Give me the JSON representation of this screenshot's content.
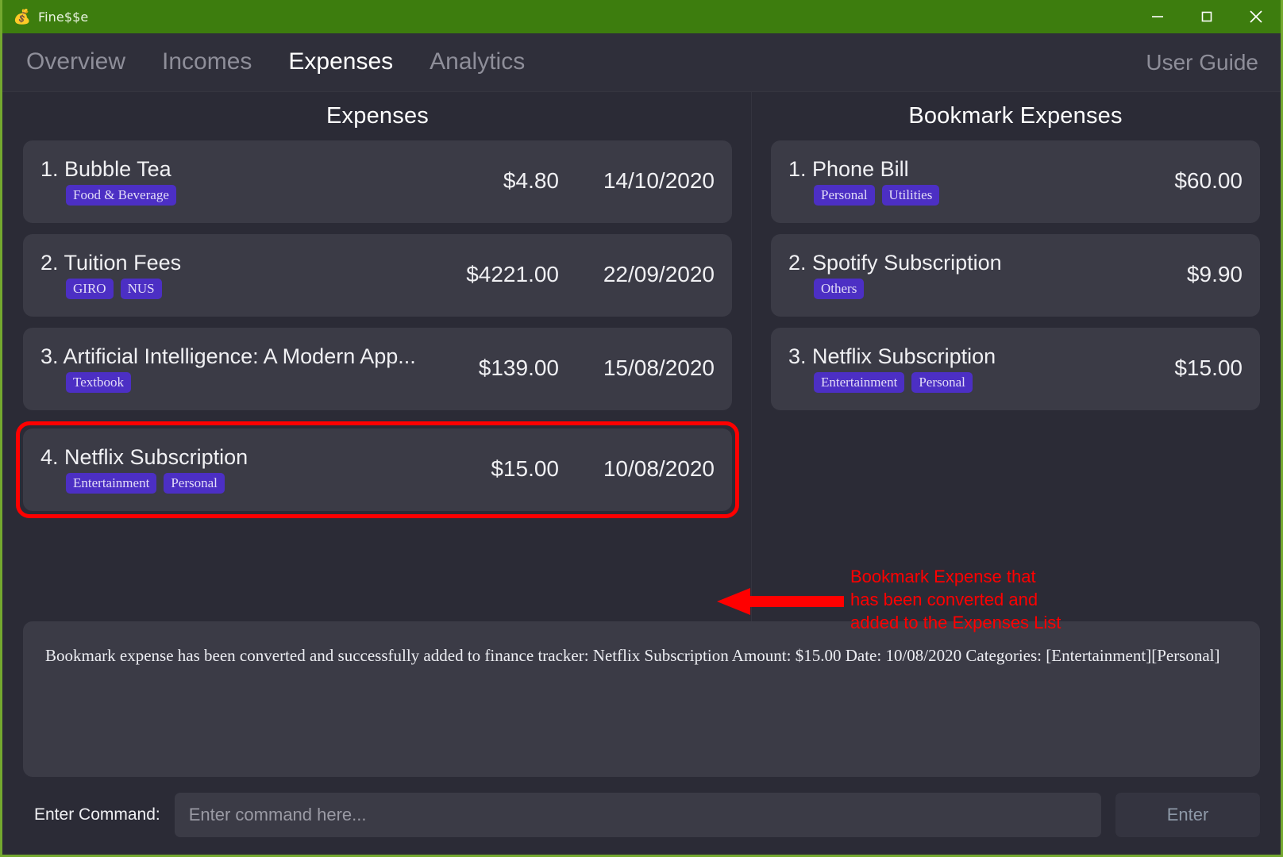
{
  "window": {
    "title": "Fine$$e",
    "icon": "money-bag-icon",
    "accent_green": "#3d7d0e",
    "background": "#2b2b36",
    "card_background": "#3b3b46",
    "tag_color": "#4c2fc4",
    "annotation_color": "#ff0000",
    "controls": {
      "minimize": "minimize-icon",
      "maximize": "maximize-icon",
      "close": "close-icon"
    }
  },
  "tabs": [
    {
      "label": "Overview",
      "active": false
    },
    {
      "label": "Incomes",
      "active": false
    },
    {
      "label": "Expenses",
      "active": true
    },
    {
      "label": "Analytics",
      "active": false
    }
  ],
  "user_guide_label": "User Guide",
  "expenses_panel": {
    "title": "Expenses",
    "items": [
      {
        "index": "1.",
        "name": "Bubble Tea",
        "title": "1. Bubble Tea",
        "tags": [
          "Food & Beverage"
        ],
        "amount": "$4.80",
        "date": "14/10/2020",
        "highlighted": false
      },
      {
        "index": "2.",
        "name": "Tuition Fees",
        "title": "2. Tuition Fees",
        "tags": [
          "GIRO",
          "NUS"
        ],
        "amount": "$4221.00",
        "date": "22/09/2020",
        "highlighted": false
      },
      {
        "index": "3.",
        "name": "Artificial Intelligence: A Modern App...",
        "title": "3. Artificial Intelligence: A Modern App...",
        "tags": [
          "Textbook"
        ],
        "amount": "$139.00",
        "date": "15/08/2020",
        "highlighted": false
      },
      {
        "index": "4.",
        "name": "Netflix Subscription",
        "title": "4. Netflix Subscription",
        "tags": [
          "Entertainment",
          "Personal"
        ],
        "amount": "$15.00",
        "date": "10/08/2020",
        "highlighted": true
      }
    ]
  },
  "bookmarks_panel": {
    "title": "Bookmark Expenses",
    "items": [
      {
        "index": "1.",
        "name": "Phone Bill",
        "title": "1. Phone Bill",
        "tags": [
          "Personal",
          "Utilities"
        ],
        "amount": "$60.00"
      },
      {
        "index": "2.",
        "name": "Spotify Subscription",
        "title": "2. Spotify Subscription",
        "tags": [
          "Others"
        ],
        "amount": "$9.90"
      },
      {
        "index": "3.",
        "name": "Netflix Subscription",
        "title": "3. Netflix Subscription",
        "tags": [
          "Entertainment",
          "Personal"
        ],
        "amount": "$15.00"
      }
    ]
  },
  "annotation": {
    "text": "Bookmark Expense that has been converted and added to the Expenses List",
    "arrow": "left-arrow-icon"
  },
  "result_box": {
    "message": "Bookmark expense has been converted and successfully added to finance tracker: Netflix Subscription Amount: $15.00 Date: 10/08/2020 Categories: [Entertainment][Personal]"
  },
  "command_bar": {
    "label": "Enter Command:",
    "input_value": "",
    "input_placeholder": "Enter command here...",
    "enter_label": "Enter"
  }
}
